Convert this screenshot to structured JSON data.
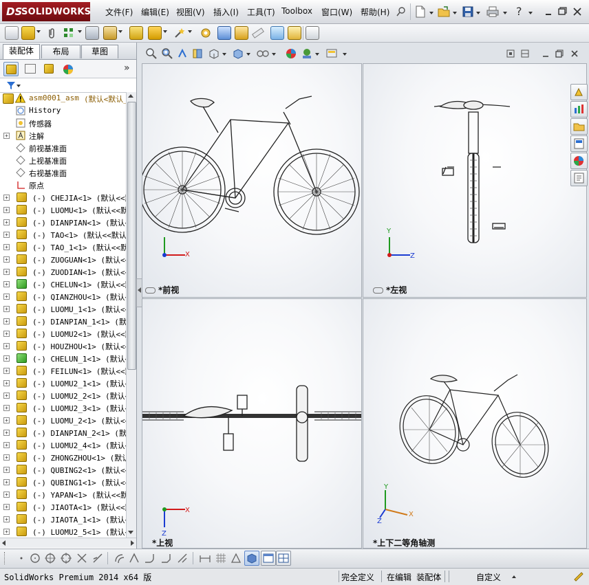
{
  "app": {
    "logo_ds": "DS",
    "logo_name": "SOLIDWORKS"
  },
  "menu": {
    "items": [
      "文件(F)",
      "编辑(E)",
      "视图(V)",
      "插入(I)",
      "工具(T)",
      "Toolbox",
      "窗口(W)",
      "帮助(H)"
    ]
  },
  "window_controls": {
    "help": "?"
  },
  "panel": {
    "tabs": [
      "装配体",
      "布局",
      "草图"
    ],
    "expand": "»",
    "assembly_name": "asm0001_asm",
    "assembly_config": "(默认<默认_",
    "tree_fixed": [
      {
        "label": "History",
        "icon": "history-icon"
      },
      {
        "label": "传感器",
        "icon": "sensor-icon"
      },
      {
        "label": "注解",
        "icon": "annotation-icon"
      },
      {
        "label": "前视基准面",
        "icon": "plane-icon"
      },
      {
        "label": "上视基准面",
        "icon": "plane-icon"
      },
      {
        "label": "右视基准面",
        "icon": "plane-icon"
      },
      {
        "label": "原点",
        "icon": "origin-icon"
      }
    ],
    "components": [
      {
        "label": "(-) CHEJIA<1> (默认<<默",
        "color": "#e9b72a"
      },
      {
        "label": "(-) LUOMU<1> (默认<<默认",
        "color": "#e9b72a"
      },
      {
        "label": "(-) DIANPIAN<1> (默认<<",
        "color": "#e9b72a"
      },
      {
        "label": "(-) TAO<1> (默认<<默认_",
        "color": "#e9b72a"
      },
      {
        "label": "(-) TAO_1<1> (默认<<默认",
        "color": "#e9b72a"
      },
      {
        "label": "(-) ZUOGUAN<1> (默认<<默",
        "color": "#e9b72a"
      },
      {
        "label": "(-) ZUODIAN<1> (默认<<默",
        "color": "#e9b72a"
      },
      {
        "label": "(-) CHELUN<1> (默认<<默认",
        "color": "#4cae34"
      },
      {
        "label": "(-) QIANZHOU<1> (默认<<",
        "color": "#e9b72a"
      },
      {
        "label": "(-) LUOMU_1<1> (默认<<默",
        "color": "#e9b72a"
      },
      {
        "label": "(-) DIANPIAN_1<1> (默认",
        "color": "#e9b72a"
      },
      {
        "label": "(-) LUOMU2<1> (默认<<默",
        "color": "#e9b72a"
      },
      {
        "label": "(-) HOUZHOU<1> (默认<<默",
        "color": "#e9b72a"
      },
      {
        "label": "(-) CHELUN_1<1> (默认<<",
        "color": "#4cae34"
      },
      {
        "label": "(-) FEILUN<1> (默认<<默认",
        "color": "#e9b72a"
      },
      {
        "label": "(-) LUOMU2_1<1> (默认<<",
        "color": "#e9b72a"
      },
      {
        "label": "(-) LUOMU2_2<1> (默认<<",
        "color": "#e9b72a"
      },
      {
        "label": "(-) LUOMU2_3<1> (默认<<",
        "color": "#e9b72a"
      },
      {
        "label": "(-) LUOMU_2<1> (默认<<默",
        "color": "#e9b72a"
      },
      {
        "label": "(-) DIANPIAN_2<1> (默认",
        "color": "#e9b72a"
      },
      {
        "label": "(-) LUOMU2_4<1> (默认<<",
        "color": "#e9b72a"
      },
      {
        "label": "(-) ZHONGZHOU<1> (默认<<",
        "color": "#e9b72a"
      },
      {
        "label": "(-) QUBING2<1> (默认<<默",
        "color": "#e9b72a"
      },
      {
        "label": "(-) QUBING1<1> (默认<<默",
        "color": "#e9b72a"
      },
      {
        "label": "(-) YAPAN<1> (默认<<默认",
        "color": "#e9b72a"
      },
      {
        "label": "(-) JIAOTA<1> (默认<<默",
        "color": "#e9b72a"
      },
      {
        "label": "(-) JIAOTA_1<1> (默认<<",
        "color": "#e9b72a"
      },
      {
        "label": "(-) LUOMU2_5<1> (默认<<",
        "color": "#e9b72a"
      }
    ]
  },
  "views": {
    "front": "*前视",
    "left": "*左视",
    "top": "*上视",
    "iso": "*上下二等角轴测"
  },
  "axes": {
    "x": "X",
    "y": "Y",
    "z": "Z"
  },
  "status": {
    "version": "SolidWorks Premium 2014 x64 版",
    "defined": "完全定义",
    "editing": "在编辑 装配体",
    "custom": "自定义"
  },
  "colors": {
    "logo": "#8a1418",
    "part_yellow": "#e9b72a",
    "part_green": "#4cae34",
    "axis_x": "#d11a1a",
    "axis_y": "#1f9a1f",
    "axis_z": "#1a3bd1"
  }
}
